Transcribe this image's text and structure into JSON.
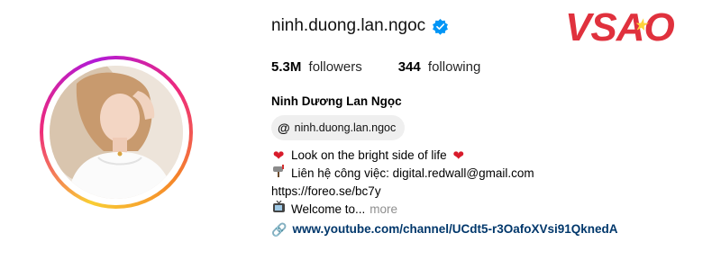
{
  "profile": {
    "username": "ninh.duong.lan.ngoc",
    "verified_icon": "verified-badge-icon",
    "followers_count": "5.3M",
    "followers_label": "followers",
    "following_count": "344",
    "following_label": "following",
    "full_name": "Ninh Dương Lan Ngọc",
    "threads_handle": "ninh.duong.lan.ngoc",
    "threads_icon": "threads-icon"
  },
  "bio": {
    "line1": "Look on the bright side of life",
    "line2": "Liên hệ công việc: digital.redwall@gmail.com",
    "line3": "https://foreo.se/bc7y",
    "line4": "Welcome to...",
    "more_label": "more",
    "link": "www.youtube.com/channel/UCdt5-r3OafoXVsi91QknedA",
    "icons": [
      "heart-icon",
      "mailbox-icon",
      "tv-icon",
      "link-icon"
    ]
  },
  "watermark": {
    "text_v": "VS",
    "text_a": "A",
    "text_o": "O"
  },
  "colors": {
    "link": "#00376b",
    "verified": "#0095f6",
    "logo": "#e0313d",
    "chip_bg": "#efefef"
  }
}
